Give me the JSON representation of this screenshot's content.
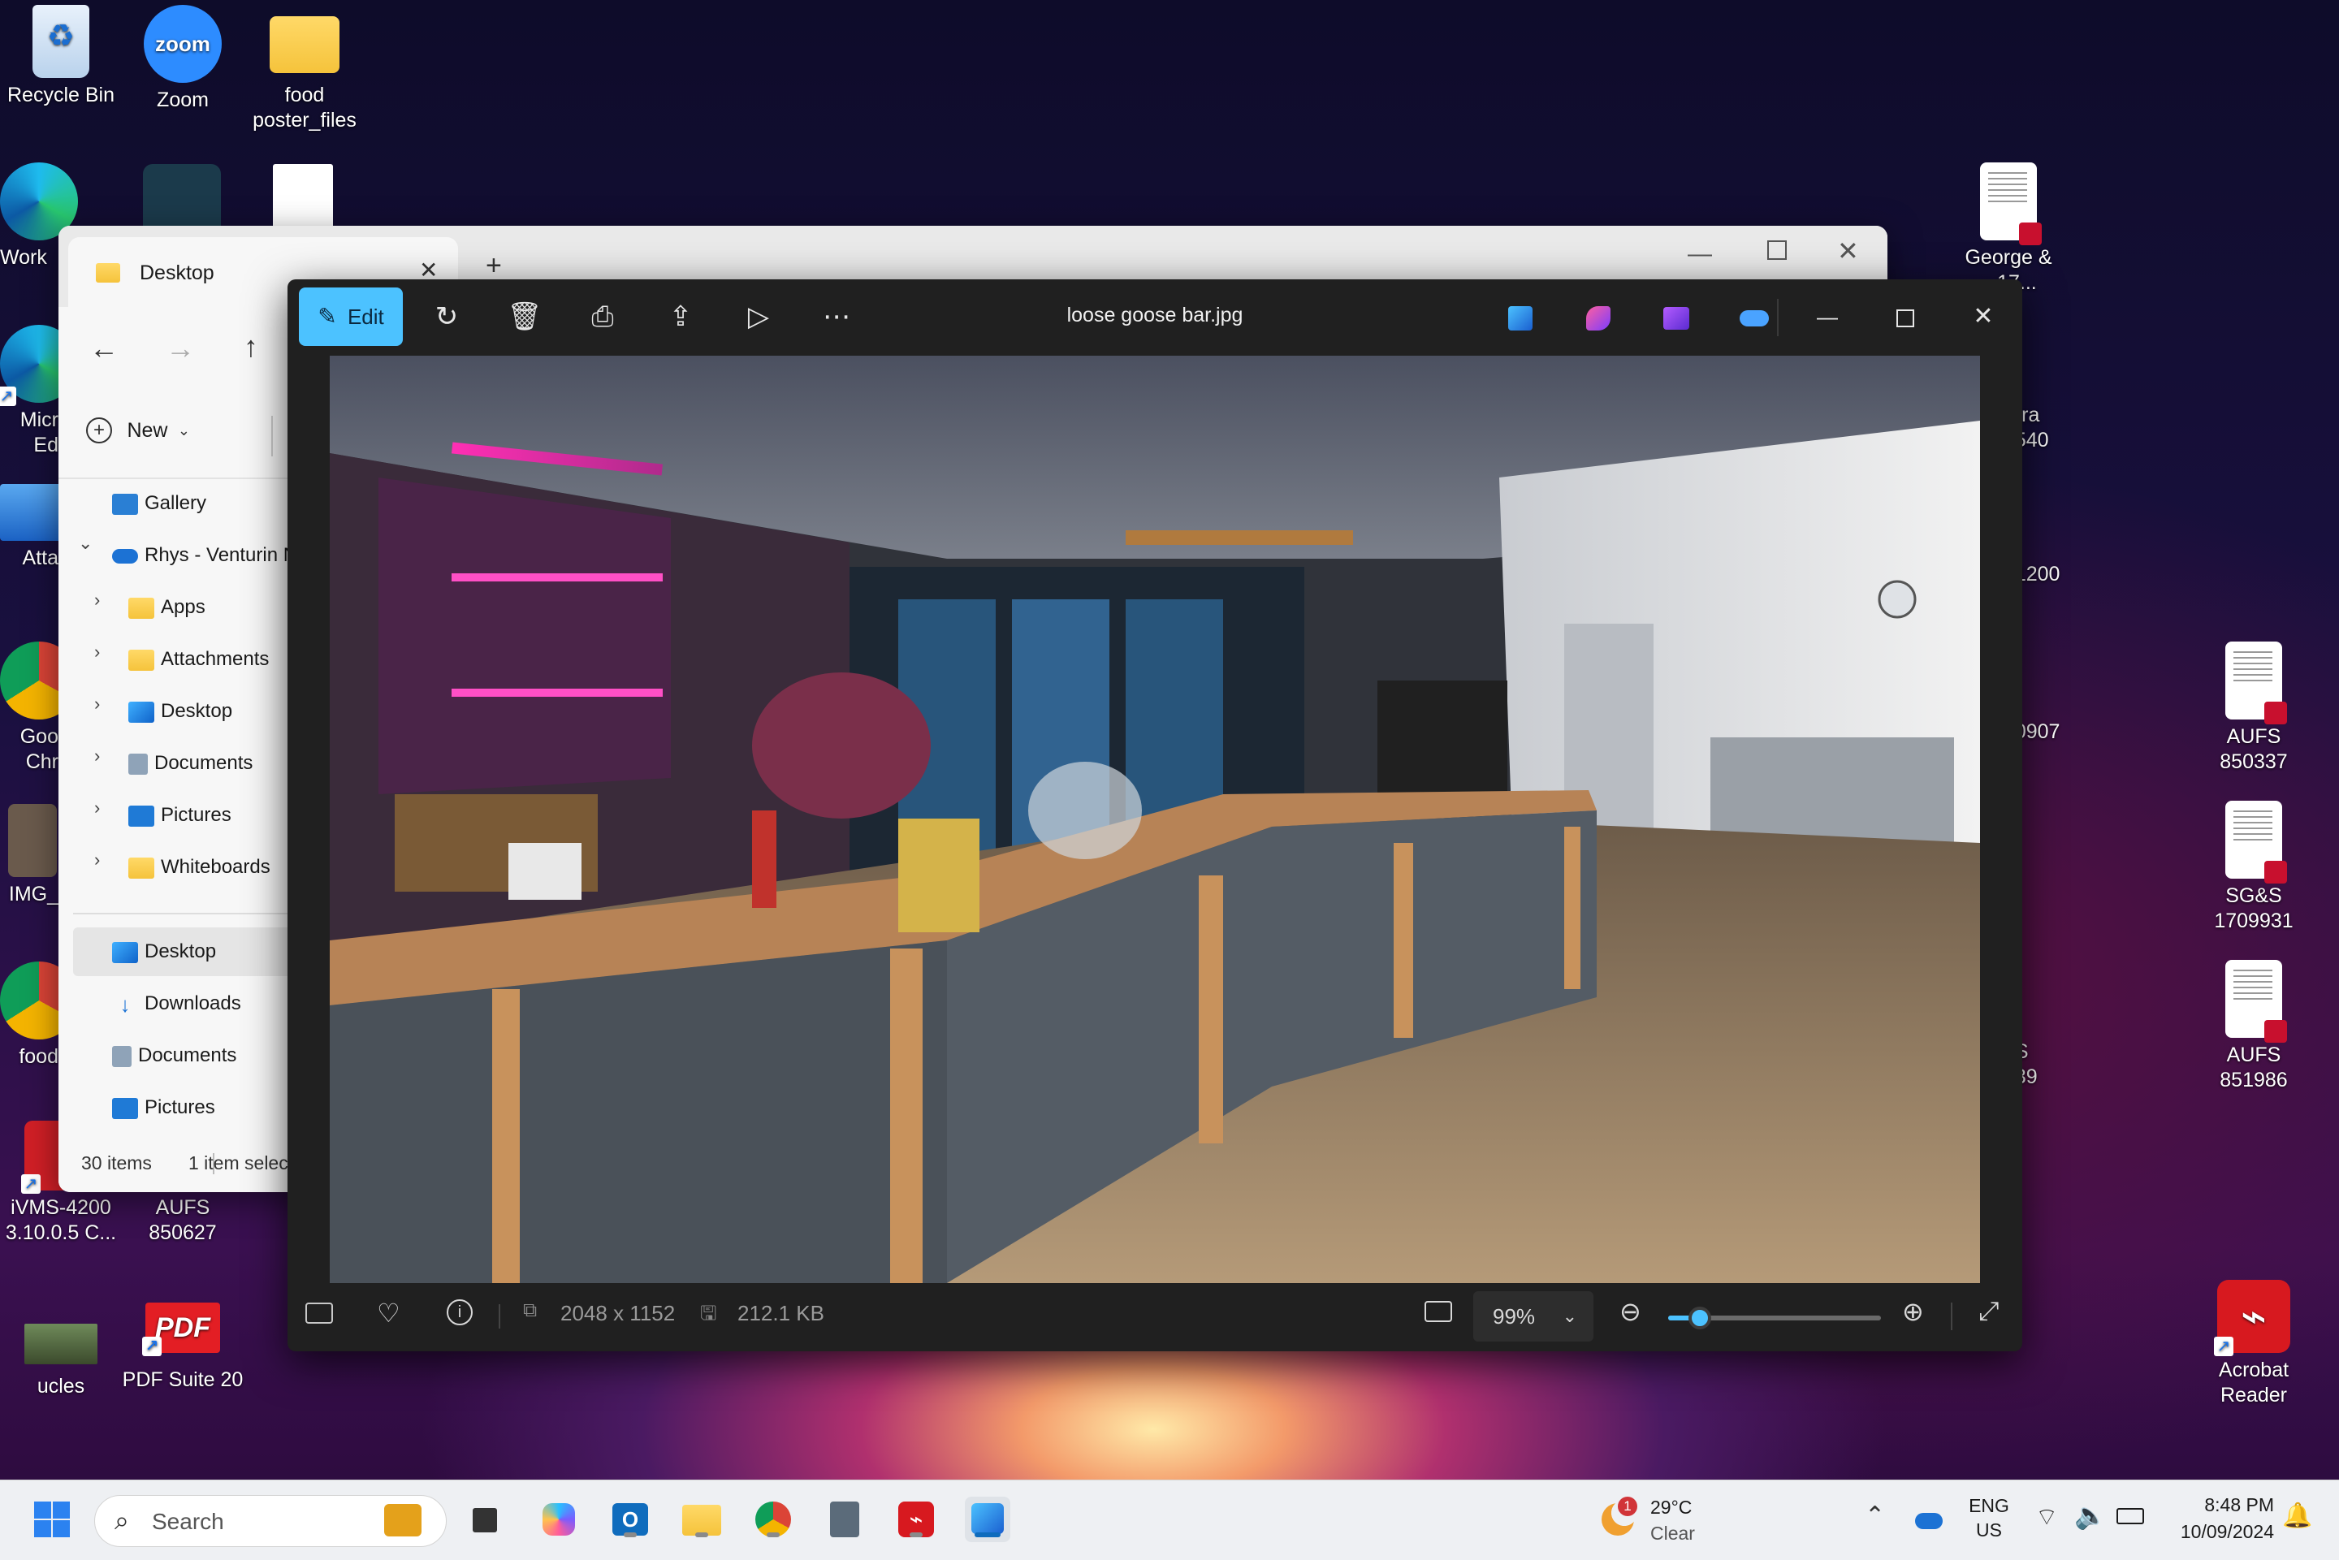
{
  "desktop": {
    "icons_left": [
      {
        "label": "Recycle Bin",
        "icon": "recycle-bin-icon"
      },
      {
        "label": "Zoom",
        "icon": "zoom-icon"
      },
      {
        "label": "food poster_files",
        "icon": "folder-icon"
      },
      {
        "label": "Work",
        "icon": "edge-icon"
      },
      {
        "label": "Micr Ed",
        "icon": "edge-icon"
      },
      {
        "label": "Atta",
        "icon": "computer-icon"
      },
      {
        "label": "Goo Chr",
        "icon": "chrome-icon"
      },
      {
        "label": "IMG_",
        "icon": "image-icon"
      },
      {
        "label": "food",
        "icon": "chrome-icon"
      },
      {
        "label": "iVMS-4200 3.10.0.5 C...",
        "icon": "ivms-icon"
      },
      {
        "label": "AUFS 850627",
        "icon": "pdf-doc-icon"
      },
      {
        "label": "ucles",
        "icon": "image-icon"
      },
      {
        "label": "PDF Suite 20",
        "icon": "pdf-suite-icon"
      }
    ],
    "icons_right": [
      {
        "label": "George & ...17...",
        "icon": "pdf-doc-icon"
      },
      {
        "label": "...rra ...540",
        "icon": "pdf-doc-icon"
      },
      {
        "label": "...1200",
        "icon": "pdf-doc-icon"
      },
      {
        "label": "...0907",
        "icon": "pdf-doc-icon"
      },
      {
        "label": "...S ...39",
        "icon": "pdf-doc-icon"
      },
      {
        "label": "AUFS 850337",
        "icon": "pdf-doc-icon"
      },
      {
        "label": "SG&S 1709931",
        "icon": "pdf-doc-icon"
      },
      {
        "label": "AUFS 851986",
        "icon": "pdf-doc-icon"
      },
      {
        "label": "Acrobat Reader",
        "icon": "acrobat-icon"
      }
    ]
  },
  "explorer": {
    "tab_title": "Desktop",
    "new_label": "New",
    "sidebar": [
      {
        "label": "Gallery",
        "icon": "gallery-icon"
      },
      {
        "label": "Rhys - Venturin N",
        "icon": "onedrive-icon"
      },
      {
        "label": "Apps",
        "icon": "folder-icon"
      },
      {
        "label": "Attachments",
        "icon": "folder-icon"
      },
      {
        "label": "Desktop",
        "icon": "desktop-folder-icon"
      },
      {
        "label": "Documents",
        "icon": "documents-icon"
      },
      {
        "label": "Pictures",
        "icon": "pictures-icon"
      },
      {
        "label": "Whiteboards",
        "icon": "folder-icon"
      },
      {
        "label": "Desktop",
        "icon": "desktop-folder-icon"
      },
      {
        "label": "Downloads",
        "icon": "downloads-icon"
      },
      {
        "label": "Documents",
        "icon": "documents-icon"
      },
      {
        "label": "Pictures",
        "icon": "pictures-icon"
      }
    ],
    "status_items": "30 items",
    "status_selected": "1 item selec"
  },
  "photos": {
    "edit_label": "Edit",
    "file_title": "loose goose bar.jpg",
    "dimensions": "2048 x 1152",
    "file_size": "212.1 KB",
    "zoom_level": "99%",
    "zoom_slider_fraction": 0.15
  },
  "taskbar": {
    "search_placeholder": "Search",
    "weather_temp": "29°C",
    "weather_desc": "Clear",
    "weather_badge": "1",
    "lang_top": "ENG",
    "lang_bottom": "US",
    "time": "8:48 PM",
    "date": "10/09/2024"
  }
}
